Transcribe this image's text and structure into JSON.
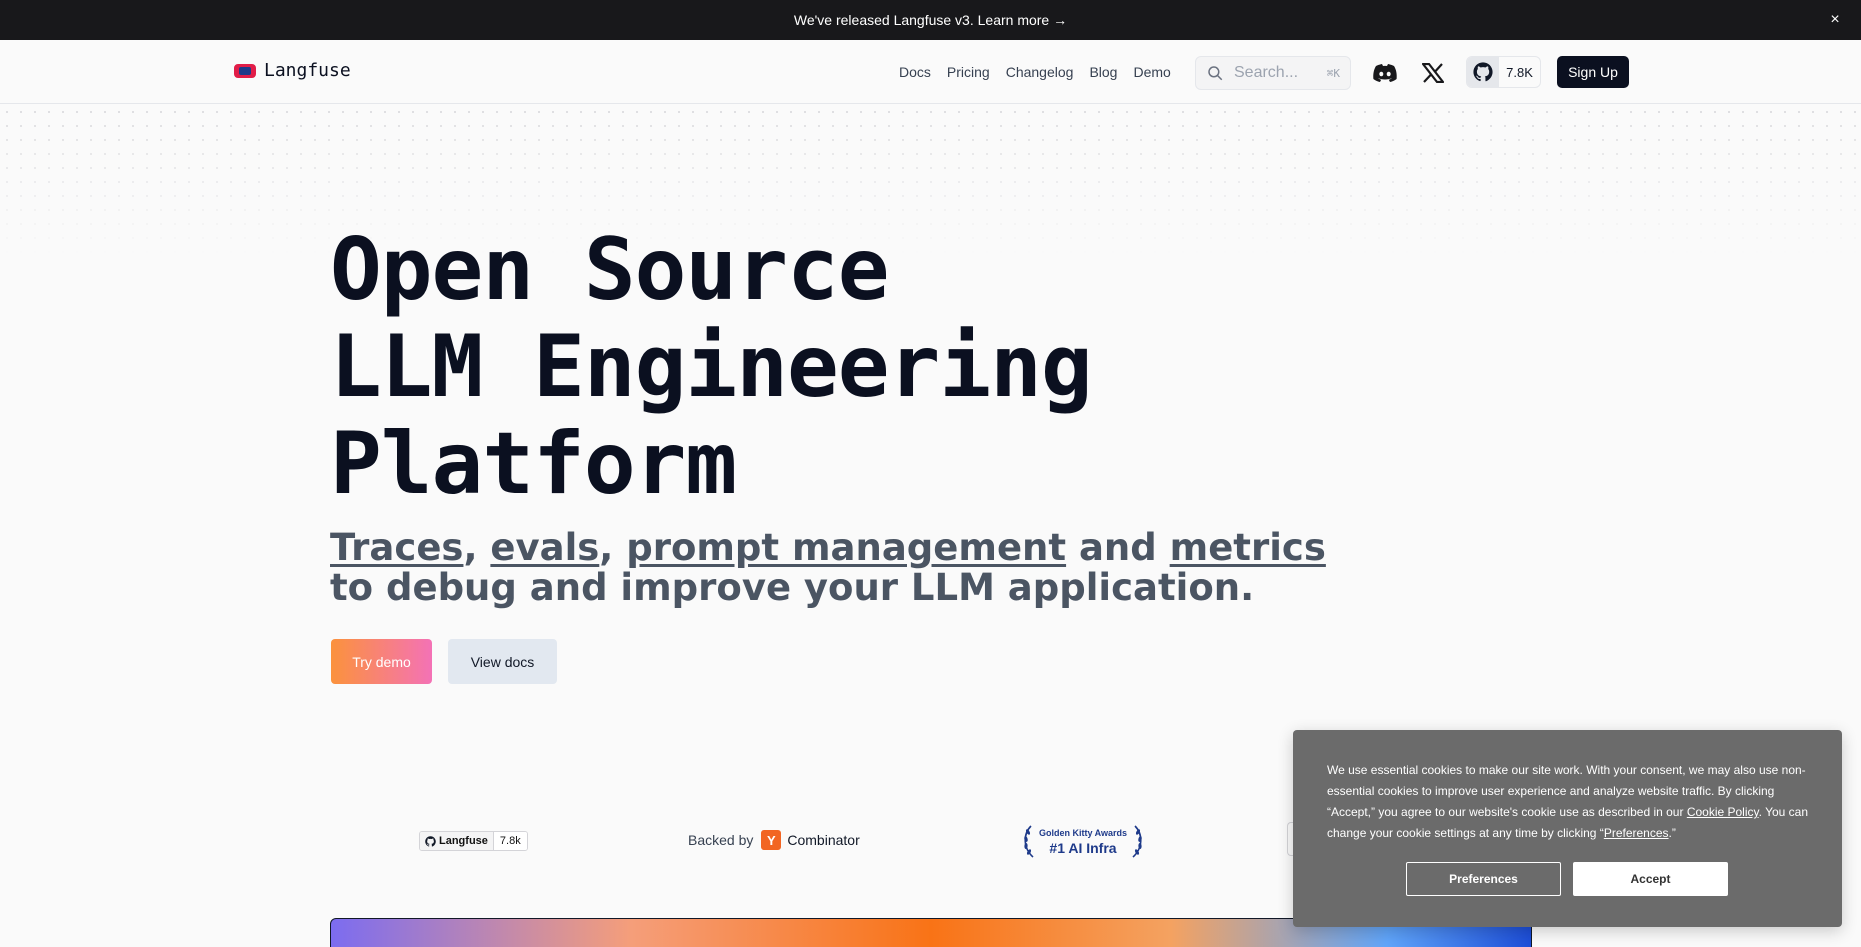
{
  "banner": {
    "text": "We've released Langfuse v3. Learn more →",
    "close_icon": "×"
  },
  "header": {
    "brand": "Langfuse",
    "nav": [
      {
        "label": "Docs"
      },
      {
        "label": "Pricing"
      },
      {
        "label": "Changelog"
      },
      {
        "label": "Blog"
      },
      {
        "label": "Demo"
      }
    ],
    "search": {
      "placeholder": "Search...",
      "shortcut": "⌘K"
    },
    "icons": [
      "discord-icon",
      "x-icon",
      "github-icon"
    ],
    "github_stars": "7.8K",
    "signup_label": "Sign Up"
  },
  "hero": {
    "title_lines": [
      "Open Source",
      "LLM Engineering",
      "Platform"
    ],
    "subtitle": {
      "w1": "Traces",
      "sep1": ", ",
      "w2": "evals",
      "sep2": ", ",
      "w3": "prompt management",
      "sep3": " and ",
      "w4": "metrics",
      "line2": "to debug and improve your LLM application."
    },
    "primary_cta": "Try demo",
    "secondary_cta": "View docs"
  },
  "badges": {
    "github": {
      "name": "Langfuse",
      "count": "7.8k"
    },
    "backed_by": "Backed by",
    "yc_letter": "Y",
    "yc_name": "Combinator",
    "golden_kitty": {
      "line1": "Golden Kitty Awards",
      "line2": "#1 AI Infra"
    }
  },
  "cookie": {
    "text_a": "We use essential cookies to make our site work. With your consent, we may also use non-essential cookies to improve user experience and analyze website traffic. By clicking “Accept,” you agree to our website's cookie use as described in our ",
    "link_policy": "Cookie Policy",
    "text_b": ". You can change your cookie settings at any time by clicking “",
    "link_prefs": "Preferences",
    "text_c": ".”",
    "preferences_label": "Preferences",
    "accept_label": "Accept"
  },
  "colors": {
    "banner_bg": "#18181b",
    "primary": "#0b1020",
    "cta_gradient_start": "#fb923c",
    "cta_gradient_end": "#f472b6",
    "cookie_bg": "#6b6b6b"
  }
}
